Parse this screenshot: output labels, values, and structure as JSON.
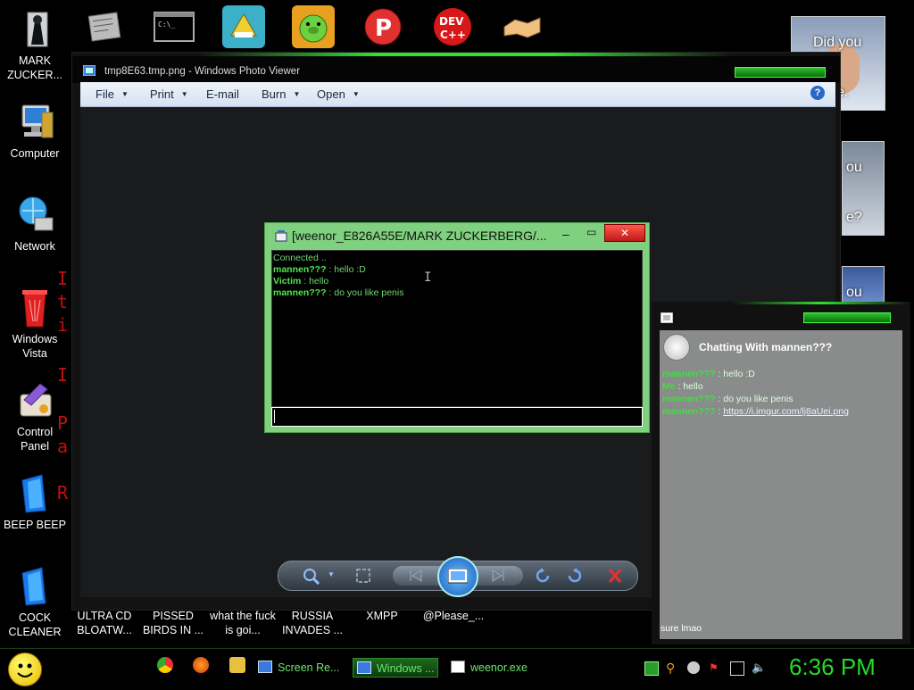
{
  "desktop_icons": [
    {
      "label": "MARK ZUCKER...",
      "icon": "person-figure-icon"
    },
    {
      "label": "Computer",
      "icon": "computer-icon"
    },
    {
      "label": "Network",
      "icon": "network-globe-icon"
    },
    {
      "label": "Windows Vista",
      "icon": "recycle-bin-icon"
    },
    {
      "label": "Control Panel",
      "icon": "control-panel-icon"
    },
    {
      "label": "BEEP BEEP",
      "icon": "blue-folder-icon"
    },
    {
      "label": "COCK CLEANER",
      "icon": "blue-folder-icon"
    }
  ],
  "bottom_icons": [
    "ULTRA CD BLOATW...",
    "PISSED BIRDS IN ...",
    "what the fuck is goi...",
    "RUSSIA INVADES ...",
    "XMPP",
    "@Please_..."
  ],
  "red_text": [
    "I",
    "t",
    "i",
    "I",
    "P",
    "a",
    "R"
  ],
  "right_thumbs": [
    {
      "lines": [
        "Did you",
        "e."
      ]
    },
    {
      "lines": [
        "ou",
        "e?"
      ]
    },
    {
      "lines": [
        "ou"
      ]
    }
  ],
  "photo_viewer": {
    "title": "tmp8E63.tmp.png - Windows Photo Viewer",
    "menus": [
      "File",
      "Print",
      "E-mail",
      "Burn",
      "Open"
    ],
    "help": "?"
  },
  "chat_window": {
    "title": "[weenor_E826A55E/MARK ZUCKERBERG/...",
    "status": "Connected ..",
    "messages": [
      {
        "sender": "mannen???",
        "text": " : hello :D"
      },
      {
        "sender": "Victim",
        "text": " : hello"
      },
      {
        "sender": "mannen???",
        "text": " : do you like penis"
      }
    ],
    "input_value": ""
  },
  "chat_panel": {
    "title": "Chatting With mannen???",
    "messages": [
      {
        "sender": "mannen???",
        "text": " : hello :D"
      },
      {
        "sender": "Me",
        "text": " : hello"
      },
      {
        "sender": "mannen???",
        "text": " : do you like penis"
      },
      {
        "sender": "mannen???",
        "text": " : ",
        "link": "https://i.imgur.com/lj8aUei.png"
      }
    ],
    "input_value": "sure lmao"
  },
  "taskbar": {
    "items": [
      {
        "label": "Screen Re..."
      },
      {
        "label": "Windows ..."
      },
      {
        "label": "weenor.exe"
      }
    ],
    "clock": "6:36 PM"
  },
  "colors": {
    "accent_green": "#33dd33",
    "clock_green": "#22dd22",
    "chat_text_green": "#6fd86f"
  }
}
